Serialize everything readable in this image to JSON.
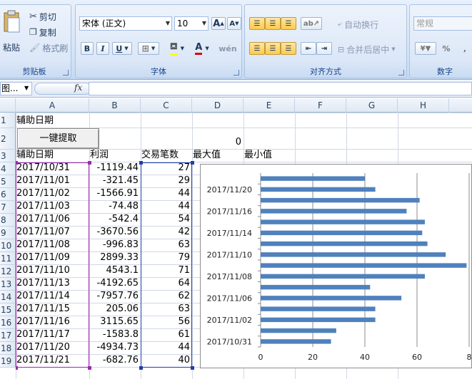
{
  "ribbon": {
    "clipboard": {
      "paste_label": "粘贴",
      "cut_label": "剪切",
      "copy_label": "复制",
      "format_painter_label": "格式刷",
      "group_label": "剪贴板"
    },
    "font": {
      "font_name": "宋体 (正文)",
      "font_size": "10",
      "grow_label": "A",
      "shrink_label": "A",
      "bold_label": "B",
      "italic_label": "I",
      "underline_label": "U",
      "group_label": "字体"
    },
    "alignment": {
      "wrap_label": "自动换行",
      "merge_label": "合并后居中",
      "group_label": "对齐方式"
    },
    "number": {
      "format_value": "常规",
      "percent_label": "%",
      "group_label": "数字"
    }
  },
  "formula_bar": {
    "name_box": "图...",
    "fx_label": "fx",
    "formula": ""
  },
  "grid": {
    "columns": [
      "A",
      "B",
      "C",
      "D",
      "E",
      "F",
      "G",
      "H"
    ],
    "rows": [
      "1",
      "2",
      "3",
      "4",
      "5",
      "6",
      "7",
      "8",
      "9",
      "10",
      "11",
      "12",
      "13",
      "14",
      "15",
      "16",
      "17",
      "18",
      "19"
    ],
    "a1": "辅助日期",
    "button_label": "一键提取",
    "d2": "0",
    "headers": [
      "辅助日期",
      "利润",
      "交易笔数",
      "最大值",
      "最小值"
    ],
    "data": [
      [
        "2017/10/31",
        "-1119.44",
        "27"
      ],
      [
        "2017/11/01",
        "-321.45",
        "29"
      ],
      [
        "2017/11/02",
        "-1566.91",
        "44"
      ],
      [
        "2017/11/03",
        "-74.48",
        "44"
      ],
      [
        "2017/11/06",
        "-542.4",
        "54"
      ],
      [
        "2017/11/07",
        "-3670.56",
        "42"
      ],
      [
        "2017/11/08",
        "-996.83",
        "63"
      ],
      [
        "2017/11/09",
        "2899.33",
        "79"
      ],
      [
        "2017/11/10",
        "4543.1",
        "71"
      ],
      [
        "2017/11/13",
        "-4192.65",
        "64"
      ],
      [
        "2017/11/14",
        "-7957.76",
        "62"
      ],
      [
        "2017/11/15",
        "205.06",
        "63"
      ],
      [
        "2017/11/16",
        "3115.65",
        "56"
      ],
      [
        "2017/11/17",
        "-1583.8",
        "61"
      ],
      [
        "2017/11/20",
        "-4934.73",
        "44"
      ],
      [
        "2017/11/21",
        "-682.76",
        "40"
      ]
    ]
  },
  "chart_data": {
    "type": "bar",
    "orientation": "horizontal",
    "categories": [
      "2017/10/31",
      "2017/11/01",
      "2017/11/02",
      "2017/11/03",
      "2017/11/06",
      "2017/11/07",
      "2017/11/08",
      "2017/11/09",
      "2017/11/10",
      "2017/11/13",
      "2017/11/14",
      "2017/11/15",
      "2017/11/16",
      "2017/11/17",
      "2017/11/20",
      "2017/11/21"
    ],
    "visible_category_labels": [
      "2017/10/31",
      "2017/11/02",
      "2017/11/06",
      "2017/11/08",
      "2017/11/10",
      "2017/11/14",
      "2017/11/16",
      "2017/11/20"
    ],
    "values": [
      27,
      29,
      44,
      44,
      54,
      42,
      63,
      79,
      71,
      64,
      62,
      63,
      56,
      61,
      44,
      40
    ],
    "xticks": [
      "0",
      "20",
      "40",
      "60",
      "8"
    ],
    "xlim": [
      0,
      80
    ],
    "title": "",
    "xlabel": "",
    "ylabel": "",
    "bar_color": "#4f81bd",
    "grid": true
  }
}
